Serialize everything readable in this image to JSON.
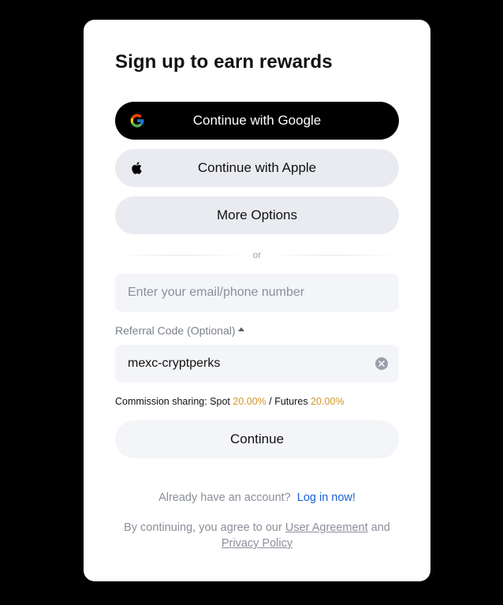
{
  "title": "Sign up to earn rewards",
  "buttons": {
    "google": "Continue with Google",
    "apple": "Continue with Apple",
    "more": "More Options",
    "continue": "Continue"
  },
  "divider_text": "or",
  "email": {
    "placeholder": "Enter your email/phone number",
    "value": ""
  },
  "referral": {
    "label": "Referral Code (Optional)",
    "value": "mexc-cryptperks"
  },
  "commission": {
    "prefix": "Commission sharing: Spot ",
    "spot": "20.00%",
    "middle": " / Futures ",
    "futures": "20.00%"
  },
  "login": {
    "text": "Already have an account?",
    "link": "Log in now!"
  },
  "agreement": {
    "prefix": "By continuing, you agree to our ",
    "user_agreement": "User Agreement",
    "and": " and ",
    "privacy_policy": "Privacy Policy"
  },
  "colors": {
    "background": "#000000",
    "card": "#ffffff",
    "accent_gold": "#d4952a",
    "link_blue": "#1a5fd6"
  },
  "icons": {
    "google": "google-icon",
    "apple": "apple-icon",
    "referral_toggle": "caret-up-icon",
    "clear": "clear-icon"
  }
}
